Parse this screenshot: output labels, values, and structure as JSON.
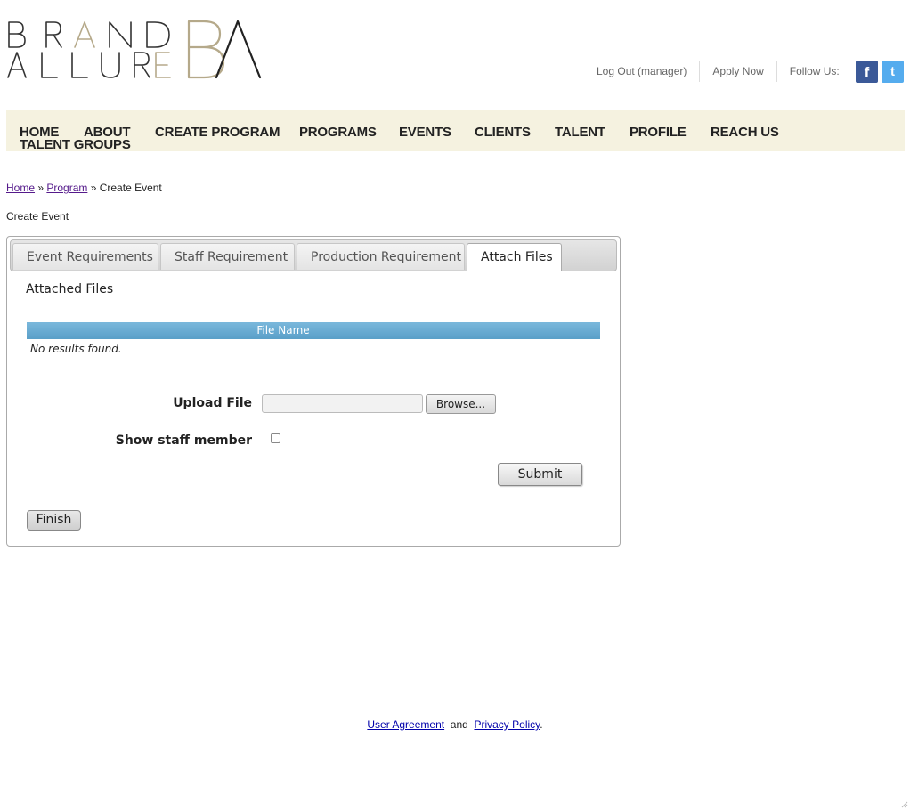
{
  "brand": {
    "line1": "BRAND",
    "line2": "ALLURE",
    "monogram": "BA"
  },
  "header": {
    "links": [
      "Log Out (manager)",
      "Apply Now",
      "Follow Us:"
    ],
    "social": [
      {
        "name": "facebook-icon",
        "glyph": "f",
        "color": "#3b5998"
      },
      {
        "name": "twitter-icon",
        "glyph": "t",
        "color": "#55acee"
      }
    ]
  },
  "nav": {
    "items": [
      "HOME",
      "ABOUT",
      "CREATE PROGRAM",
      "PROGRAMS",
      "EVENTS",
      "CLIENTS",
      "TALENT",
      "PROFILE",
      "REACH US",
      "TALENT GROUPS"
    ]
  },
  "breadcrumb": {
    "home": "Home",
    "sep1": " » ",
    "program": "Program",
    "sep2": " » ",
    "current": "Create Event"
  },
  "page_title": "Create Event",
  "tabs": [
    {
      "label": "Event Requirements",
      "active": false
    },
    {
      "label": "Staff Requirement",
      "active": false
    },
    {
      "label": "Production Requirement",
      "active": false
    },
    {
      "label": "Attach Files",
      "active": true
    }
  ],
  "attach": {
    "title": "Attached Files",
    "grid": {
      "columns": [
        "File Name",
        ""
      ],
      "empty_text": "No results found."
    },
    "upload_label": "Upload File",
    "browse_label": "Browse...",
    "show_staff_label": "Show staff member",
    "show_staff_checked": false,
    "submit_label": "Submit",
    "finish_label": "Finish"
  },
  "footer": {
    "user_agreement": "User Agreement",
    "and": "and",
    "privacy": "Privacy Policy",
    "period": "."
  },
  "colors": {
    "nav_bg": "#f5f2e0",
    "grid_header": "#6aacd4",
    "brand_gold": "#b5a98a",
    "brand_dark": "#222222"
  }
}
